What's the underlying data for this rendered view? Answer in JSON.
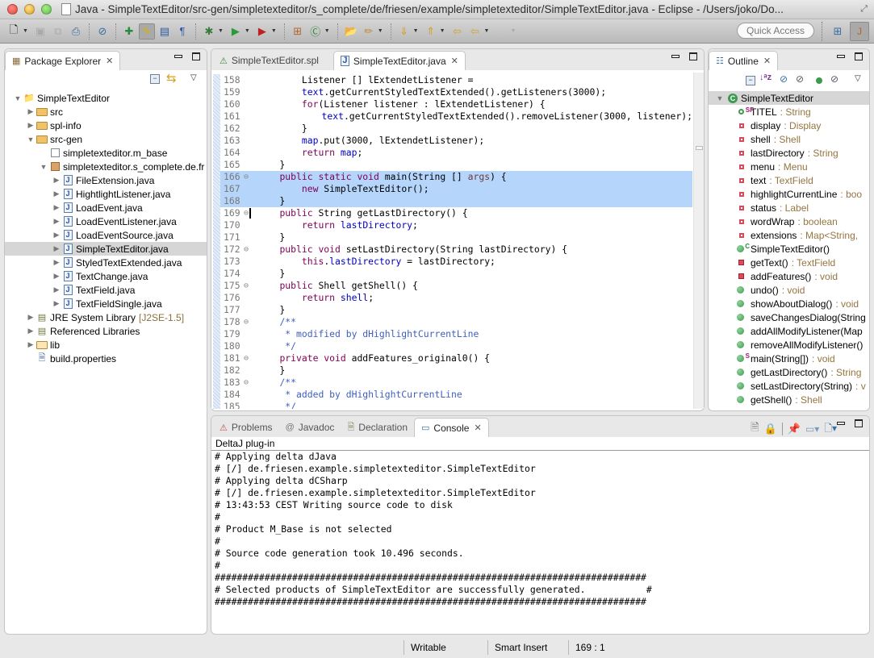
{
  "window": {
    "title": "Java - SimpleTextEditor/src-gen/simpletexteditor/s_complete/de/friesen/example/simpletexteditor/SimpleTextEditor.java - Eclipse - /Users/joko/Do..."
  },
  "toolbar": {
    "quick_access_placeholder": "Quick Access",
    "icons": [
      "new-icon",
      "save-icon",
      "save-all-icon",
      "print-icon",
      "toggle-breadcrumb-icon",
      "open-type-icon",
      "mark-occurrences-icon",
      "block-selection-icon",
      "show-whitespace-icon",
      "debug-icon",
      "run-icon",
      "external-tools-icon",
      "new-package-icon",
      "new-class-icon",
      "open-folder-icon",
      "search-icon",
      "next-annotation-icon",
      "previous-annotation-icon",
      "last-edit-location-icon",
      "back-icon",
      "forward-icon"
    ],
    "perspectives": [
      "open-perspective-icon",
      "java-perspective-icon"
    ]
  },
  "package_explorer": {
    "tab_label": "Package Explorer",
    "tree": [
      {
        "label": "SimpleTextEditor",
        "depth": 0,
        "expanded": true,
        "icon": "project"
      },
      {
        "label": "src",
        "depth": 1,
        "expanded": false,
        "icon": "source-folder"
      },
      {
        "label": "spl-info",
        "depth": 1,
        "expanded": false,
        "icon": "source-folder"
      },
      {
        "label": "src-gen",
        "depth": 1,
        "expanded": true,
        "icon": "source-folder"
      },
      {
        "label": "simpletexteditor.m_base",
        "depth": 2,
        "expanded": null,
        "icon": "empty-package"
      },
      {
        "label": "simpletexteditor.s_complete.de.fr",
        "depth": 2,
        "expanded": true,
        "icon": "package"
      },
      {
        "label": "FileExtension.java",
        "depth": 3,
        "expanded": false,
        "icon": "java-file"
      },
      {
        "label": "HightlightListener.java",
        "depth": 3,
        "expanded": false,
        "icon": "java-file"
      },
      {
        "label": "LoadEvent.java",
        "depth": 3,
        "expanded": false,
        "icon": "java-file"
      },
      {
        "label": "LoadEventListener.java",
        "depth": 3,
        "expanded": false,
        "icon": "java-file"
      },
      {
        "label": "LoadEventSource.java",
        "depth": 3,
        "expanded": false,
        "icon": "java-file"
      },
      {
        "label": "SimpleTextEditor.java",
        "depth": 3,
        "expanded": false,
        "icon": "java-file",
        "selected": true
      },
      {
        "label": "StyledTextExtended.java",
        "depth": 3,
        "expanded": false,
        "icon": "java-file"
      },
      {
        "label": "TextChange.java",
        "depth": 3,
        "expanded": false,
        "icon": "java-file"
      },
      {
        "label": "TextField.java",
        "depth": 3,
        "expanded": false,
        "icon": "java-file"
      },
      {
        "label": "TextFieldSingle.java",
        "depth": 3,
        "expanded": false,
        "icon": "java-file"
      },
      {
        "label": "JRE System Library",
        "decoration": "[J2SE-1.5]",
        "depth": 1,
        "expanded": false,
        "icon": "library"
      },
      {
        "label": "Referenced Libraries",
        "depth": 1,
        "expanded": false,
        "icon": "library"
      },
      {
        "label": "lib",
        "depth": 1,
        "expanded": false,
        "icon": "folder"
      },
      {
        "label": "build.properties",
        "depth": 1,
        "expanded": null,
        "icon": "properties-file"
      }
    ]
  },
  "editor": {
    "tabs": [
      {
        "label": "SimpleTextEditor.spl",
        "active": false
      },
      {
        "label": "SimpleTextEditor.java",
        "active": true
      }
    ],
    "lines": [
      {
        "n": "158",
        "fold": false,
        "hl": false,
        "tokens": [
          [
            "t",
            "        Listener [] lExtendetListener = "
          ]
        ]
      },
      {
        "n": "159",
        "fold": false,
        "hl": false,
        "tokens": [
          [
            "t",
            "        "
          ],
          [
            "f",
            "text"
          ],
          [
            "t",
            ".getCurrentStyledTextExtended().getListeners(3000);"
          ]
        ]
      },
      {
        "n": "160",
        "fold": false,
        "hl": false,
        "tokens": [
          [
            "t",
            "        "
          ],
          [
            "k",
            "for"
          ],
          [
            "t",
            "(Listener listener : lExtendetListener) {"
          ]
        ]
      },
      {
        "n": "161",
        "fold": false,
        "hl": false,
        "tokens": [
          [
            "t",
            "            "
          ],
          [
            "f",
            "text"
          ],
          [
            "t",
            ".getCurrentStyledTextExtended().removeListener(3000, listener);"
          ]
        ]
      },
      {
        "n": "162",
        "fold": false,
        "hl": false,
        "tokens": [
          [
            "t",
            "        }"
          ]
        ]
      },
      {
        "n": "163",
        "fold": false,
        "hl": false,
        "tokens": [
          [
            "t",
            "        "
          ],
          [
            "f",
            "map"
          ],
          [
            "t",
            ".put(3000, lExtendetListener);"
          ]
        ]
      },
      {
        "n": "164",
        "fold": false,
        "hl": false,
        "tokens": [
          [
            "t",
            "        "
          ],
          [
            "k",
            "return"
          ],
          [
            "t",
            " "
          ],
          [
            "f",
            "map"
          ],
          [
            "t",
            ";"
          ]
        ]
      },
      {
        "n": "165",
        "fold": false,
        "hl": false,
        "tokens": [
          [
            "t",
            "    }"
          ]
        ]
      },
      {
        "n": "166",
        "fold": true,
        "hl": true,
        "tokens": [
          [
            "t",
            "    "
          ],
          [
            "k",
            "public static void"
          ],
          [
            "t",
            " main(String [] "
          ],
          [
            "v",
            "args"
          ],
          [
            "t",
            ") {"
          ]
        ]
      },
      {
        "n": "167",
        "fold": false,
        "hl": true,
        "tokens": [
          [
            "t",
            "        "
          ],
          [
            "k",
            "new"
          ],
          [
            "t",
            " SimpleTextEditor();"
          ]
        ]
      },
      {
        "n": "168",
        "fold": false,
        "hl": true,
        "tokens": [
          [
            "t",
            "    }"
          ]
        ]
      },
      {
        "n": "169",
        "fold": true,
        "hl": false,
        "caret": true,
        "tokens": [
          [
            "t",
            "    "
          ],
          [
            "k",
            "public"
          ],
          [
            "t",
            " String getLastDirectory() {"
          ]
        ]
      },
      {
        "n": "170",
        "fold": false,
        "hl": false,
        "tokens": [
          [
            "t",
            "        "
          ],
          [
            "k",
            "return"
          ],
          [
            "t",
            " "
          ],
          [
            "f",
            "lastDirectory"
          ],
          [
            "t",
            ";"
          ]
        ]
      },
      {
        "n": "171",
        "fold": false,
        "hl": false,
        "tokens": [
          [
            "t",
            "    }"
          ]
        ]
      },
      {
        "n": "172",
        "fold": true,
        "hl": false,
        "tokens": [
          [
            "t",
            "    "
          ],
          [
            "k",
            "public void"
          ],
          [
            "t",
            " setLastDirectory(String lastDirectory) {"
          ]
        ]
      },
      {
        "n": "173",
        "fold": false,
        "hl": false,
        "tokens": [
          [
            "t",
            "        "
          ],
          [
            "k",
            "this"
          ],
          [
            "t",
            "."
          ],
          [
            "f",
            "lastDirectory"
          ],
          [
            "t",
            " = lastDirectory;"
          ]
        ]
      },
      {
        "n": "174",
        "fold": false,
        "hl": false,
        "tokens": [
          [
            "t",
            "    }"
          ]
        ]
      },
      {
        "n": "175",
        "fold": true,
        "hl": false,
        "tokens": [
          [
            "t",
            "    "
          ],
          [
            "k",
            "public"
          ],
          [
            "t",
            " Shell getShell() {"
          ]
        ]
      },
      {
        "n": "176",
        "fold": false,
        "hl": false,
        "tokens": [
          [
            "t",
            "        "
          ],
          [
            "k",
            "return"
          ],
          [
            "t",
            " "
          ],
          [
            "f",
            "shell"
          ],
          [
            "t",
            ";"
          ]
        ]
      },
      {
        "n": "177",
        "fold": false,
        "hl": false,
        "tokens": [
          [
            "t",
            "    }"
          ]
        ]
      },
      {
        "n": "178",
        "fold": true,
        "hl": false,
        "tokens": [
          [
            "t",
            "    "
          ],
          [
            "d",
            "/**"
          ]
        ]
      },
      {
        "n": "179",
        "fold": false,
        "hl": false,
        "tokens": [
          [
            "t",
            "     "
          ],
          [
            "d",
            "* modified by dHighlightCurrentLine"
          ]
        ]
      },
      {
        "n": "180",
        "fold": false,
        "hl": false,
        "tokens": [
          [
            "t",
            "     "
          ],
          [
            "d",
            "*/"
          ]
        ]
      },
      {
        "n": "181",
        "fold": true,
        "hl": false,
        "tokens": [
          [
            "t",
            "    "
          ],
          [
            "k",
            "private void"
          ],
          [
            "t",
            " addFeatures_original0() {"
          ]
        ]
      },
      {
        "n": "182",
        "fold": false,
        "hl": false,
        "tokens": [
          [
            "t",
            "    }"
          ]
        ]
      },
      {
        "n": "183",
        "fold": true,
        "hl": false,
        "tokens": [
          [
            "t",
            "    "
          ],
          [
            "d",
            "/**"
          ]
        ]
      },
      {
        "n": "184",
        "fold": false,
        "hl": false,
        "tokens": [
          [
            "t",
            "     "
          ],
          [
            "d",
            "* added by dHighlightCurrentLine"
          ]
        ]
      },
      {
        "n": "185",
        "fold": false,
        "hl": false,
        "tokens": [
          [
            "t",
            "     "
          ],
          [
            "d",
            "*/"
          ]
        ]
      }
    ]
  },
  "outline": {
    "tab_label": "Outline",
    "root": "SimpleTextEditor",
    "items": [
      {
        "name": "TITEL",
        "type": "String",
        "kind": "static-final-field",
        "sup": "SF"
      },
      {
        "name": "display",
        "type": "Display",
        "kind": "private-field"
      },
      {
        "name": "shell",
        "type": "Shell",
        "kind": "private-field"
      },
      {
        "name": "lastDirectory",
        "type": "String",
        "kind": "private-field"
      },
      {
        "name": "menu",
        "type": "Menu",
        "kind": "private-field"
      },
      {
        "name": "text",
        "type": "TextField",
        "kind": "private-field"
      },
      {
        "name": "highlightCurrentLine",
        "type": "boo",
        "kind": "private-field"
      },
      {
        "name": "status",
        "type": "Label",
        "kind": "private-field"
      },
      {
        "name": "wordWrap",
        "type": "boolean",
        "kind": "private-field"
      },
      {
        "name": "extensions",
        "type": "Map<String,",
        "kind": "private-field"
      },
      {
        "name": "SimpleTextEditor()",
        "type": "",
        "kind": "constructor",
        "sup": "C"
      },
      {
        "name": "getText()",
        "type": "TextField",
        "kind": "private-method"
      },
      {
        "name": "addFeatures()",
        "type": "void",
        "kind": "private-method"
      },
      {
        "name": "undo()",
        "type": "void",
        "kind": "public-method"
      },
      {
        "name": "showAboutDialog()",
        "type": "void",
        "kind": "public-method"
      },
      {
        "name": "saveChangesDialog(String",
        "type": "",
        "kind": "public-method"
      },
      {
        "name": "addAllModifyListener(Map",
        "type": "",
        "kind": "public-method"
      },
      {
        "name": "removeAllModifyListener()",
        "type": "",
        "kind": "public-method"
      },
      {
        "name": "main(String[])",
        "type": "void",
        "kind": "static-method",
        "sup": "S"
      },
      {
        "name": "getLastDirectory()",
        "type": "String",
        "kind": "public-method"
      },
      {
        "name": "setLastDirectory(String)",
        "type": "v",
        "kind": "public-method"
      },
      {
        "name": "getShell()",
        "type": "Shell",
        "kind": "public-method"
      }
    ]
  },
  "bottom_panel": {
    "tabs": [
      {
        "label": "Problems",
        "active": false,
        "icon": "problems-icon"
      },
      {
        "label": "Javadoc",
        "active": false,
        "icon": "javadoc-icon"
      },
      {
        "label": "Declaration",
        "active": false,
        "icon": "declaration-icon"
      },
      {
        "label": "Console",
        "active": true,
        "icon": "console-icon"
      }
    ],
    "console_name": "DeltaJ plug-in",
    "console_lines": [
      "# Applying delta dJava",
      "# [/] de.friesen.example.simpletexteditor.SimpleTextEditor",
      "# Applying delta dCSharp",
      "# [/] de.friesen.example.simpletexteditor.SimpleTextEditor",
      "# 13:43:53 CEST Writing source code to disk",
      "#",
      "# Product M_Base is not selected",
      "#",
      "# Source code generation took 10.496 seconds.",
      "#",
      "##############################################################################",
      "# Selected products of SimpleTextEditor are successfully generated.           #",
      "##############################################################################"
    ]
  },
  "status_bar": {
    "mode": "Writable",
    "insert_mode": "Smart Insert",
    "position": "169 : 1"
  }
}
